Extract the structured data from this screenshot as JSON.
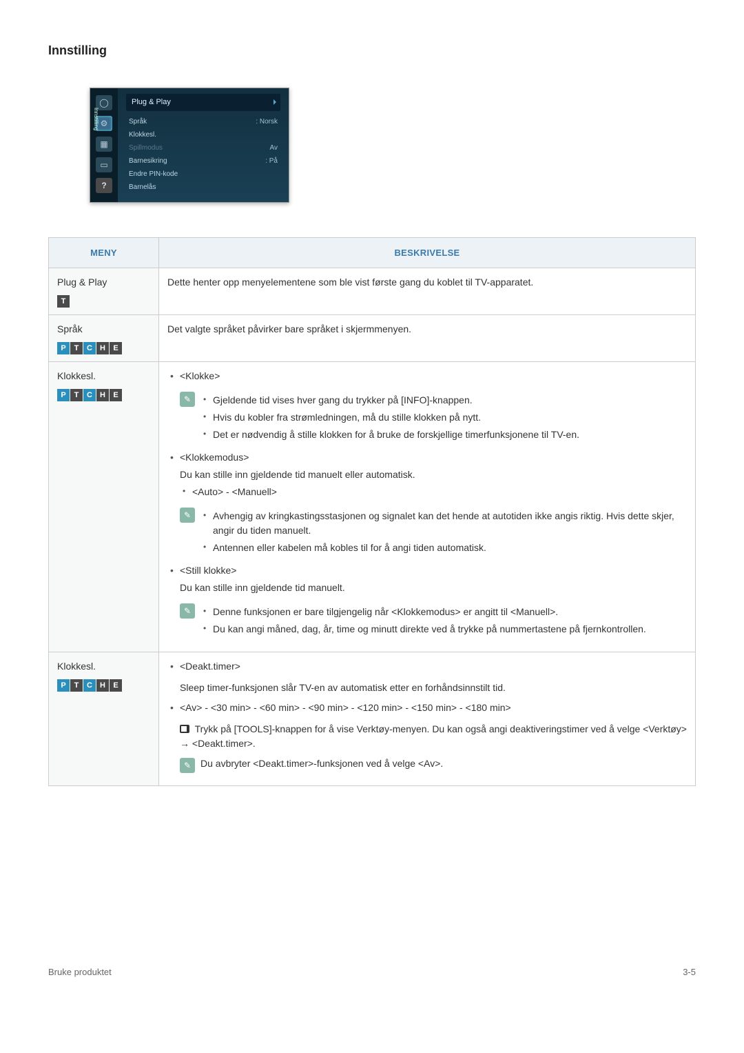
{
  "title": "Innstilling",
  "screenshot": {
    "sideLabel": "Innstilling",
    "topItem": "Plug & Play",
    "rows": [
      {
        "label": "Språk",
        "value": ": Norsk",
        "dim": false
      },
      {
        "label": "Klokkesl.",
        "value": "",
        "dim": false
      },
      {
        "label": "Spillmodus",
        "value": "Av",
        "dim": true
      },
      {
        "label": "Barnesikring",
        "value": ": På",
        "dim": false
      },
      {
        "label": "Endre PIN-kode",
        "value": "",
        "dim": false
      },
      {
        "label": "Barnelås",
        "value": "",
        "dim": false
      }
    ]
  },
  "table": {
    "headMeny": "MENY",
    "headDesc": "BESKRIVELSE",
    "rows": [
      {
        "name": "Plug & Play",
        "badges": [
          "T"
        ],
        "desc_simple": "Dette henter opp menyelementene som ble vist første gang du koblet til TV-apparatet."
      },
      {
        "name": "Språk",
        "badges": [
          "P",
          "T",
          "C",
          "H",
          "E"
        ],
        "desc_simple": "Det valgte språket påvirker bare språket i skjermmenyen."
      },
      {
        "name": "Klokkesl.",
        "badges": [
          "P",
          "T",
          "C",
          "H",
          "E"
        ],
        "klokke": {
          "h": "<Klokke>",
          "n1": "Gjeldende tid vises hver gang du trykker på [INFO]-knappen.",
          "n2": "Hvis du kobler fra strømledningen, må du stille klokken på nytt.",
          "n3": "Det er nødvendig å stille klokken for å bruke de forskjellige timerfunksjonene til TV-en."
        },
        "modus": {
          "h": "<Klokkemodus>",
          "sub": "Du kan stille inn gjeldende tid manuelt eller automatisk.",
          "opt": "<Auto> - <Manuell>",
          "n1": "Avhengig av kringkastingsstasjonen og signalet kan det hende at autotiden ikke angis riktig. Hvis dette skjer, angir du tiden manuelt.",
          "n2": "Antennen eller kabelen må kobles til for å angi tiden automatisk."
        },
        "still": {
          "h": "<Still klokke>",
          "sub": "Du kan stille inn gjeldende tid manuelt.",
          "n1": "Denne funksjonen er bare tilgjengelig når <Klokkemodus> er angitt til <Manuell>.",
          "n2": "Du kan angi måned, dag, år, time og minutt direkte ved å trykke på nummertastene på fjernkontrollen."
        }
      },
      {
        "name": "Klokkesl.",
        "badges": [
          "P",
          "T",
          "C",
          "H",
          "E"
        ],
        "deakt": {
          "h": "<Deakt.timer>",
          "p1": "Sleep timer-funksjonen slår TV-en av automatisk etter en forhåndsinnstilt tid.",
          "opt": "<Av> - <30 min> - <60 min> - <90 min> - <120 min> - <150 min> - <180 min>",
          "tool": "Trykk på [TOOLS]-knappen for å vise Verktøy-menyen. Du kan også angi deaktiveringstimer ved å velge <Verktøy> → <Deakt.timer>.",
          "note": "Du avbryter <Deakt.timer>-funksjonen ved å velge <Av>."
        }
      }
    ]
  },
  "footer": {
    "left": "Bruke produktet",
    "right": "3-5"
  }
}
